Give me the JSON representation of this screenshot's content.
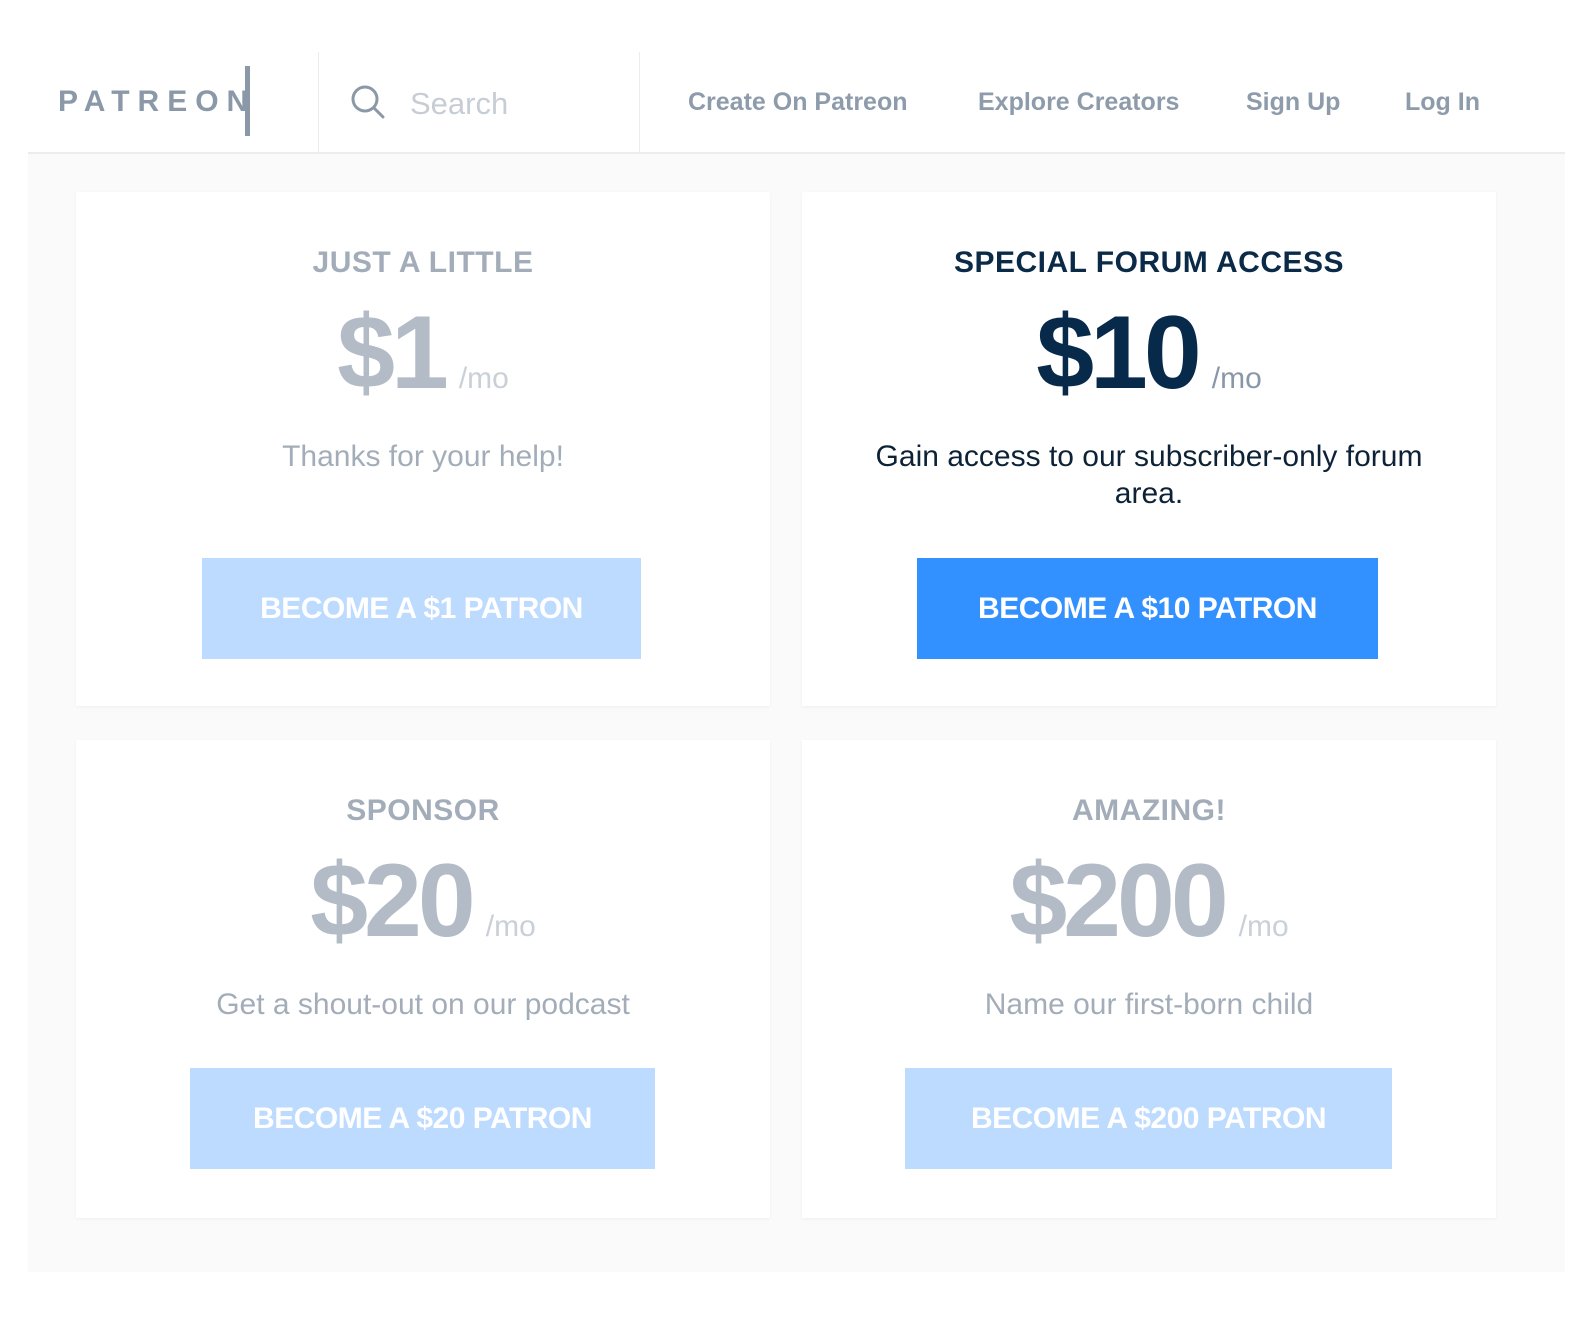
{
  "header": {
    "logo": "PATREON",
    "search_placeholder": "Search",
    "nav": {
      "create": "Create On Patreon",
      "explore": "Explore Creators",
      "signup": "Sign Up",
      "login": "Log In"
    }
  },
  "tiers": [
    {
      "name": "JUST A LITTLE",
      "price": "$1",
      "period": "/mo",
      "description": "Thanks for your help!",
      "button": "BECOME A $1 PATRON"
    },
    {
      "name": "SPECIAL FORUM ACCESS",
      "price": "$10",
      "period": "/mo",
      "description": "Gain access to our subscriber-only forum area.",
      "button": "BECOME A $10 PATRON"
    },
    {
      "name": "SPONSOR",
      "price": "$20",
      "period": "/mo",
      "description": "Get a shout-out on our podcast",
      "button": "BECOME A $20 PATRON"
    },
    {
      "name": "AMAZING!",
      "price": "$200",
      "period": "/mo",
      "description": "Name our first-born child",
      "button": "BECOME A $200 PATRON"
    }
  ],
  "colors": {
    "accent": "#3390ff",
    "accent_muted": "#bddaff",
    "heading_active": "#0a2a47",
    "muted_text": "#a3adb9"
  },
  "icons": {
    "search": "search-icon"
  }
}
